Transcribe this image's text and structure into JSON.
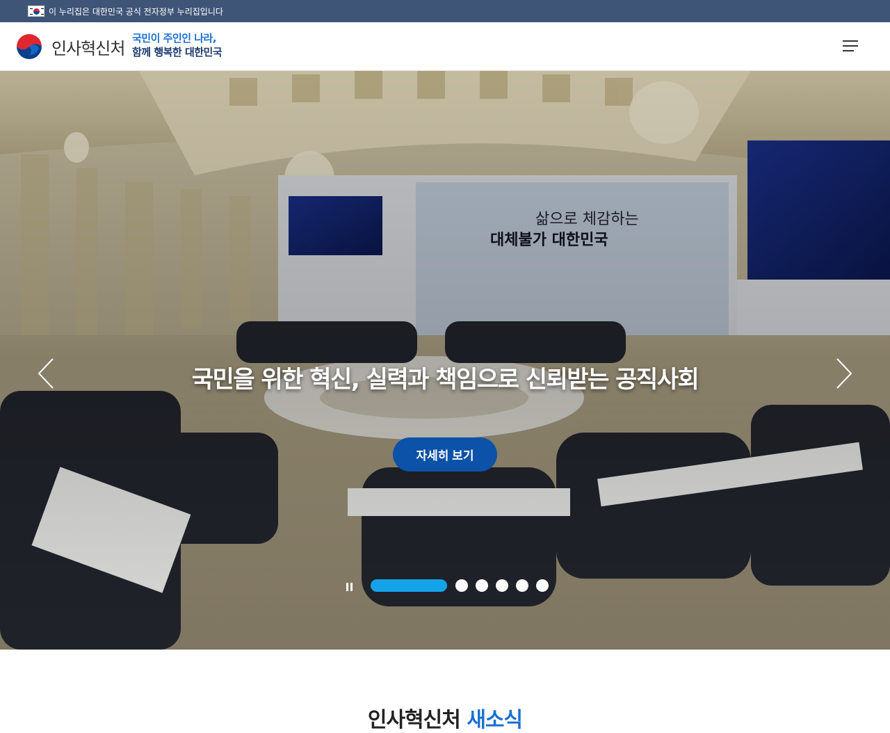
{
  "banner": {
    "text": "이 누리집은 대한민국 공식 전자정부 누리집입니다"
  },
  "header": {
    "logo_text": "인사혁신처",
    "slogan_line1": "국민이 주인인 나라,",
    "slogan_line2": "함께 행복한 대한민국"
  },
  "hero": {
    "title": "국민을 위한 혁신, 실력과 책임으로 신뢰받는 공직사회",
    "button_label": "자세히 보기",
    "slide_count": 6,
    "active_slide": 1
  },
  "section": {
    "title_part1": "인사혁신처",
    "title_part2": "새소식"
  },
  "colors": {
    "banner": "#3f5577",
    "accent": "#1a6fd0",
    "button": "#0b52a8",
    "pager_active": "#14a3e8"
  }
}
